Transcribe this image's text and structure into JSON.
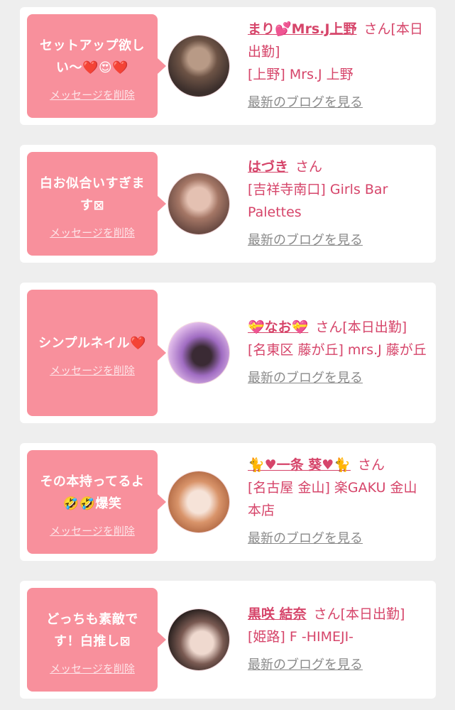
{
  "cards": [
    {
      "message": "セットアップ欲しい〜❤️😍❤️",
      "delete_label": "メッセージを削除",
      "name": "まり💕Mrs.J上野",
      "honorific": "さん[本日出勤]",
      "shop": "[上野] Mrs.J 上野",
      "blog_label": "最新のブログを見る",
      "avatar_colors": [
        "#3c2f2c",
        "#b89a86"
      ]
    },
    {
      "message": "白お似合いすぎます⊠",
      "delete_label": "メッセージを削除",
      "name": "はづき",
      "honorific": "さん",
      "shop": "[吉祥寺南口] Girls Bar Palettes",
      "blog_label": "最新のブログを見る",
      "avatar_colors": [
        "#6b4b43",
        "#e4c1b2"
      ]
    },
    {
      "message": "シンプルネイル❤️",
      "delete_label": "メッセージを削除",
      "name": "💝なお💝",
      "honorific": "さん[本日出勤]",
      "shop": "[名東区 藤が丘] mrs.J 藤が丘",
      "blog_label": "最新のブログを見る",
      "avatar_colors": [
        "#a06cc2",
        "#e9c6ef"
      ]
    },
    {
      "message": "その本持ってるよ🤣🤣爆笑",
      "delete_label": "メッセージを削除",
      "name": "🐈♥一条 葵♥🐈",
      "honorific": "さん",
      "shop": "[名古屋 金山] 楽GAKU 金山本店",
      "blog_label": "最新のブログを見る",
      "avatar_colors": [
        "#d9946a",
        "#f6e3d8"
      ]
    },
    {
      "message": "どっちも素敵です！白推し⊠",
      "delete_label": "メッセージを削除",
      "name": "黒咲 結奈",
      "honorific": "さん[本日出勤]",
      "shop": "[姫路] F -HIMEJI-",
      "blog_label": "最新のブログを見る",
      "avatar_colors": [
        "#2b2220",
        "#efd9cf"
      ]
    }
  ]
}
